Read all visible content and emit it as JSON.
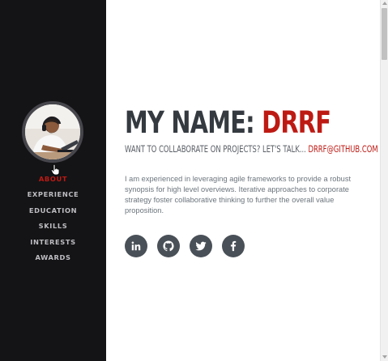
{
  "sidebar": {
    "nav": [
      {
        "label": "ABOUT",
        "active": true
      },
      {
        "label": "EXPERIENCE",
        "active": false
      },
      {
        "label": "EDUCATION",
        "active": false
      },
      {
        "label": "SKILLS",
        "active": false
      },
      {
        "label": "INTERESTS",
        "active": false
      },
      {
        "label": "AWARDS",
        "active": false
      }
    ]
  },
  "main": {
    "title_prefix": "MY NAME: ",
    "title_name": "DRRF",
    "subtitle_text": "WANT TO COLLABORATE ON PROJECTS? LET'S TALK... ",
    "subtitle_email": "DRRF@GITHUB.COM",
    "bio": "I am experienced in leveraging agile frameworks to provide a robust synopsis for high level overviews. Iterative approaches to corporate strategy foster collaborative thinking to further the overall value proposition.",
    "socials": [
      "linkedin-icon",
      "github-icon",
      "twitter-icon",
      "facebook-icon"
    ]
  },
  "colors": {
    "sidebar_bg": "#141416",
    "accent": "#bd1a14",
    "heading": "#343a40",
    "social_bg": "#495057"
  }
}
